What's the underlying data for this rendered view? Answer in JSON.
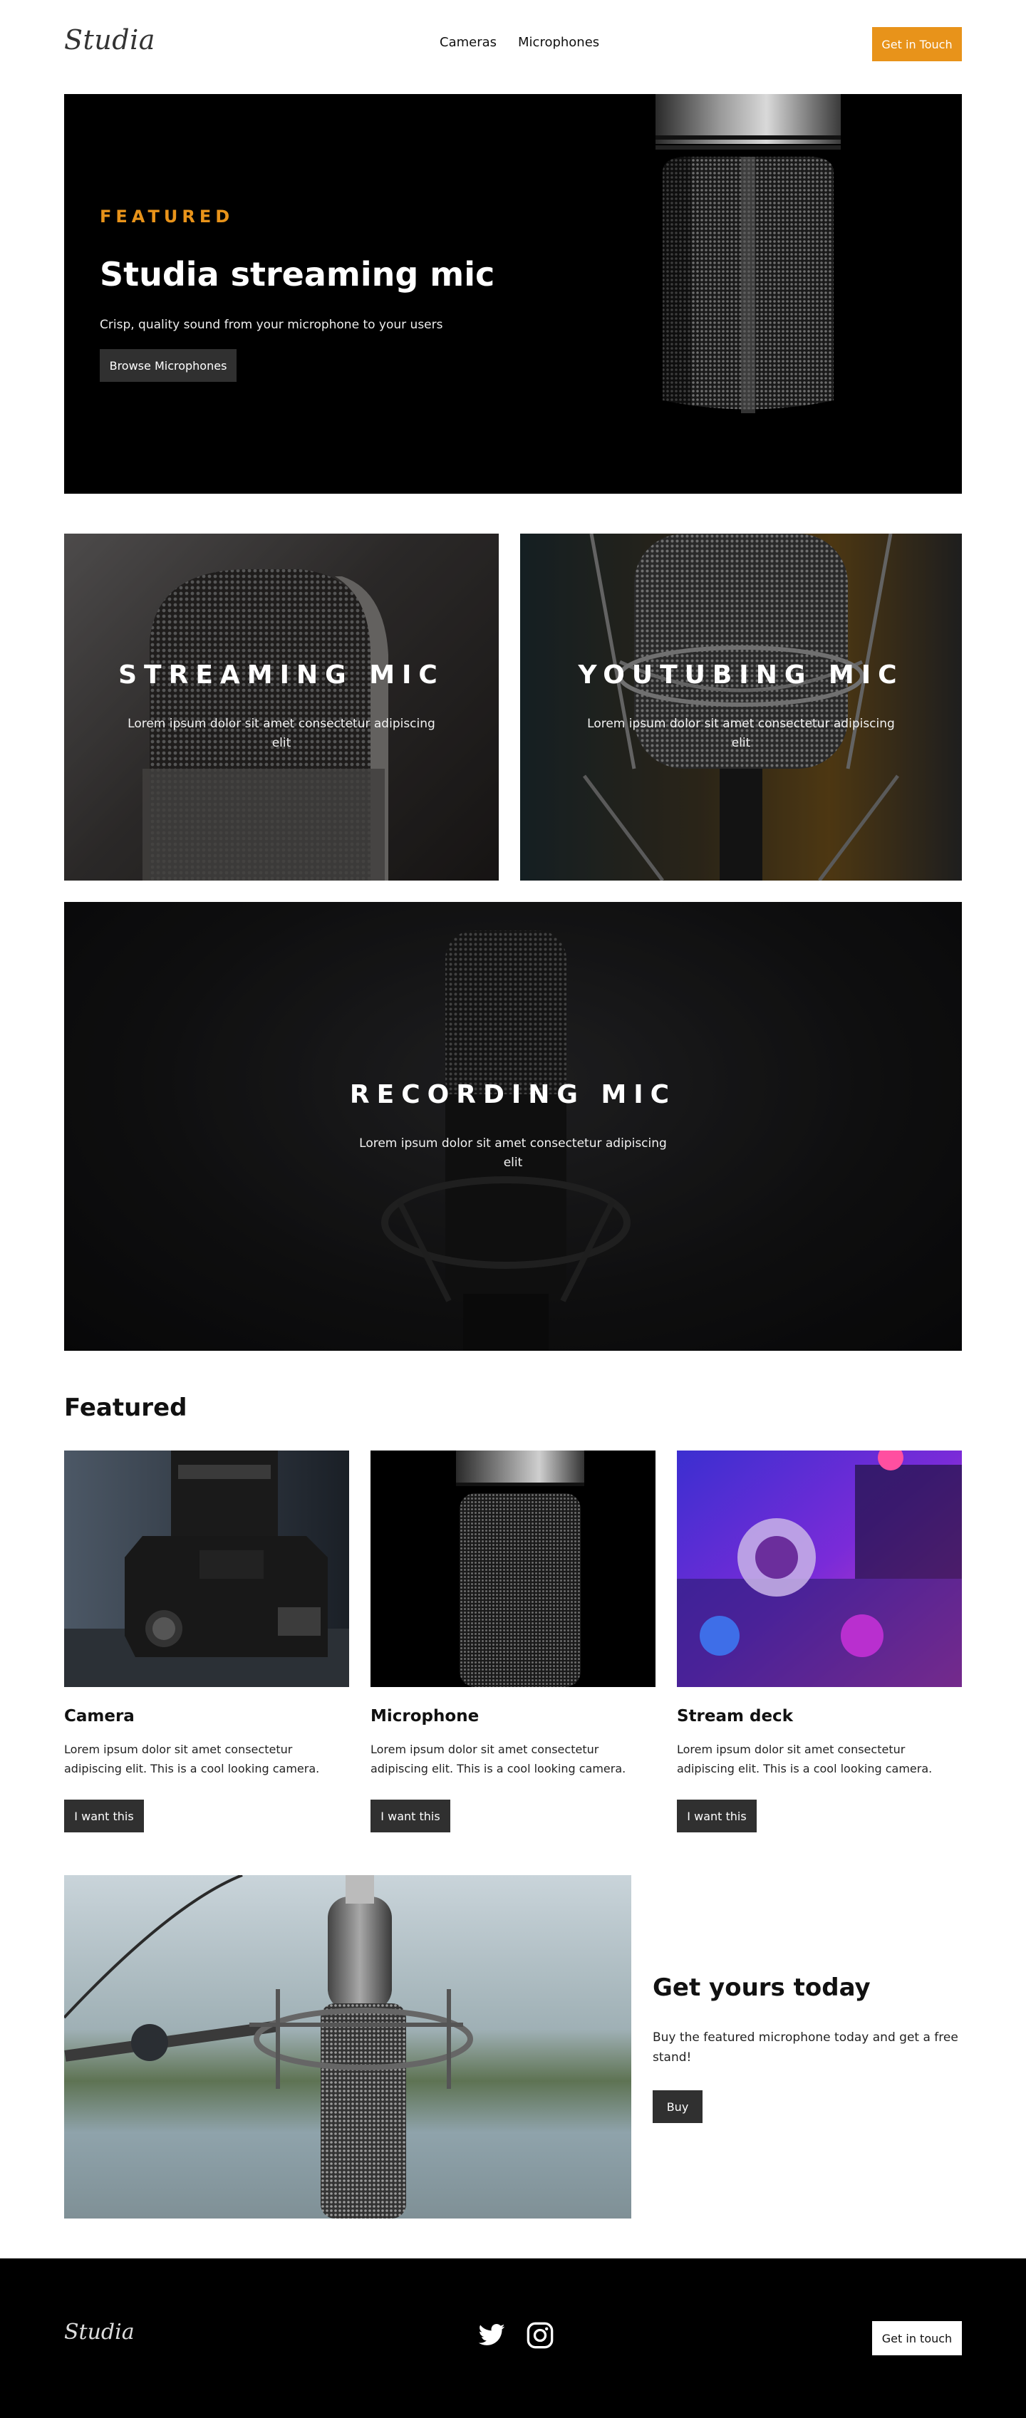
{
  "header": {
    "logo": "Studia",
    "nav": [
      "Cameras",
      "Microphones"
    ],
    "cta": "Get in Touch"
  },
  "hero": {
    "eyebrow": "FEATURED",
    "title": "Studia streaming mic",
    "subtitle": "Crisp, quality sound from your microphone to your users",
    "button": "Browse Microphones"
  },
  "tiles": [
    {
      "title": "STREAMING MIC",
      "text": "Lorem ipsum dolor sit amet consectetur adipiscing elit"
    },
    {
      "title": "YOUTUBING MIC",
      "text": "Lorem ipsum dolor sit amet consectetur adipiscing elit"
    },
    {
      "title": "RECORDING MIC",
      "text": "Lorem ipsum dolor sit amet consectetur adipiscing elit"
    }
  ],
  "featured": {
    "heading": "Featured",
    "cards": [
      {
        "title": "Camera",
        "text": "Lorem ipsum dolor sit amet consectetur adipiscing elit. This is a cool looking camera.",
        "button": "I want this"
      },
      {
        "title": "Microphone",
        "text": "Lorem ipsum dolor sit amet consectetur adipiscing elit. This is a cool looking camera.",
        "button": "I want this"
      },
      {
        "title": "Stream deck",
        "text": "Lorem ipsum dolor sit amet consectetur adipiscing elit. This is a cool looking camera.",
        "button": "I want this"
      }
    ]
  },
  "promo": {
    "title": "Get yours today",
    "text": "Buy the featured microphone today and get a free stand!",
    "button": "Buy"
  },
  "footer": {
    "logo": "Studia",
    "social": [
      "twitter-icon",
      "instagram-icon"
    ],
    "cta": "Get in touch"
  },
  "colors": {
    "accent": "#e8931a",
    "dark_button": "#303030",
    "footer_bg": "#000000"
  }
}
